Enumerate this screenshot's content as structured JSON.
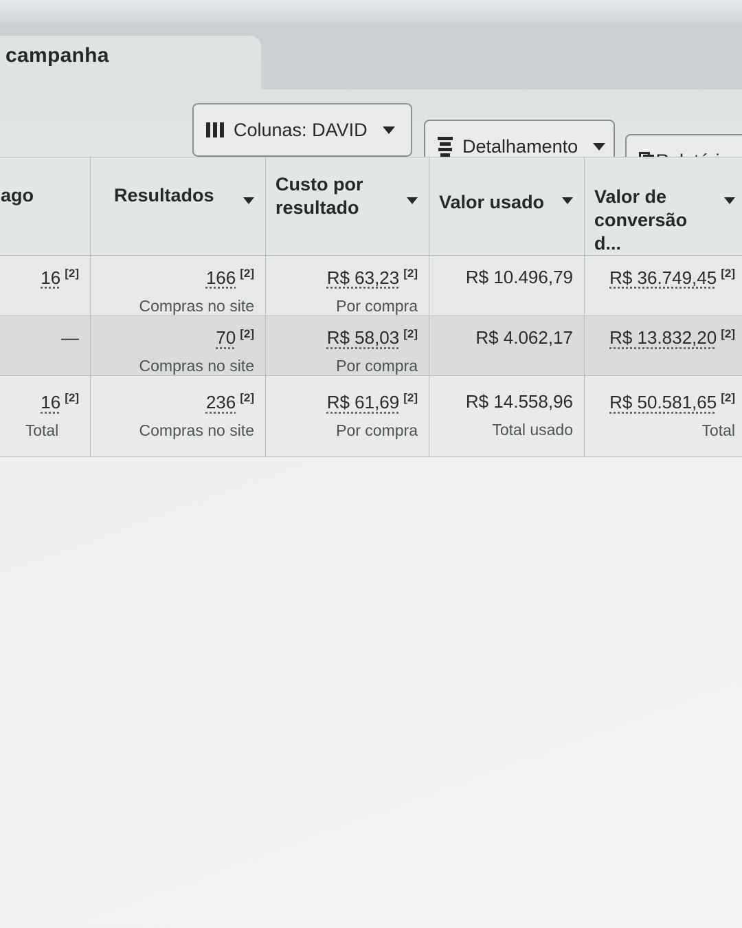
{
  "tab": {
    "label": "campanha"
  },
  "toolbar": {
    "columns_label": "Colunas: DAVID",
    "breakdown_label": "Detalhamento",
    "reports_label": "Relatórios"
  },
  "table": {
    "headers": [
      "ago",
      "Resultados",
      "Custo por resultado",
      "Valor usado",
      "Valor de conversão d..."
    ],
    "rows": [
      {
        "c0": "16",
        "c0_note": "[2]",
        "c1": "166",
        "c1_note": "[2]",
        "c1_sub": "Compras no site",
        "c2": "R$ 63,23",
        "c2_note": "[2]",
        "c2_sub": "Por compra",
        "c3": "R$ 10.496,79",
        "c4": "R$ 36.749,45",
        "c4_note": "[2]"
      },
      {
        "c0": "—",
        "c1": "70",
        "c1_note": "[2]",
        "c1_sub": "Compras no site",
        "c2": "R$ 58,03",
        "c2_note": "[2]",
        "c2_sub": "Por compra",
        "c3": "R$ 4.062,17",
        "c4": "R$ 13.832,20",
        "c4_note": "[2]"
      }
    ],
    "total": {
      "c0": "16",
      "c0_note": "[2]",
      "c0_sub": "Total",
      "c1": "236",
      "c1_note": "[2]",
      "c1_sub": "Compras no site",
      "c2": "R$ 61,69",
      "c2_note": "[2]",
      "c2_sub": "Por compra",
      "c3": "R$ 14.558,96",
      "c3_sub": "Total usado",
      "c4": "R$ 50.581,65",
      "c4_note": "[2]",
      "c4_sub": "Total"
    }
  }
}
